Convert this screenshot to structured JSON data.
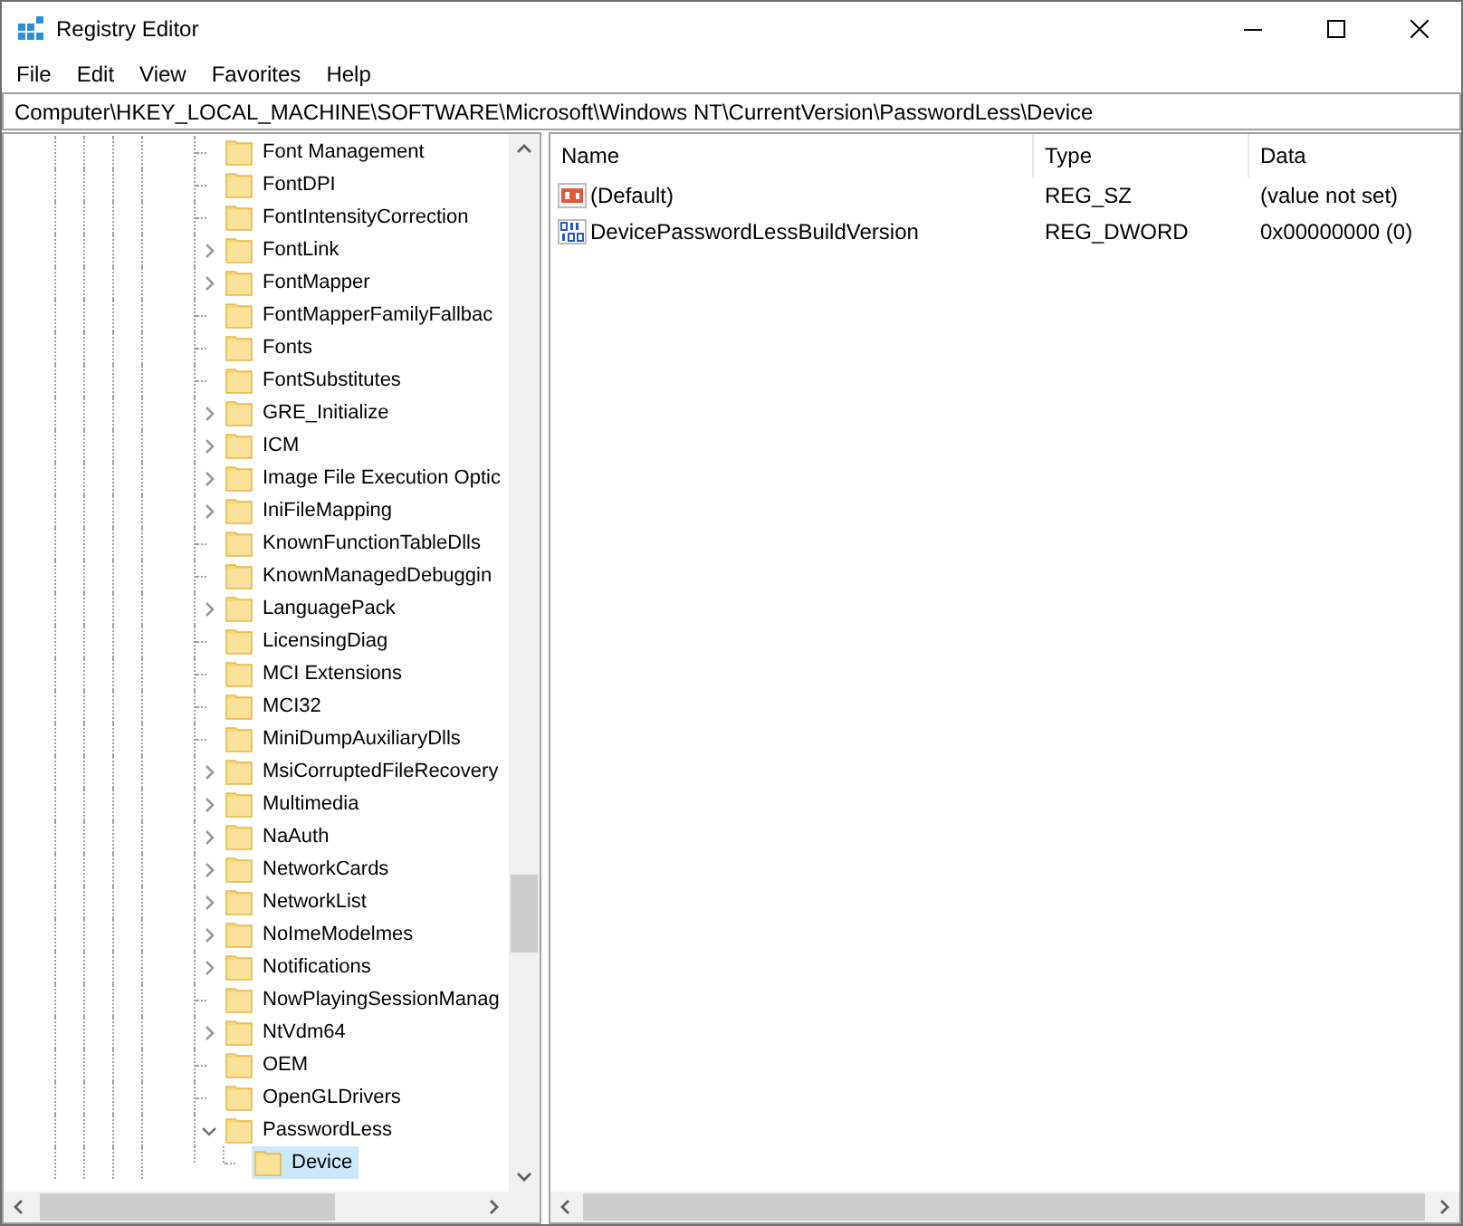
{
  "window": {
    "title": "Registry Editor"
  },
  "menu": [
    "File",
    "Edit",
    "View",
    "Favorites",
    "Help"
  ],
  "address": "Computer\\HKEY_LOCAL_MACHINE\\SOFTWARE\\Microsoft\\Windows NT\\CurrentVersion\\PasswordLess\\Device",
  "tree": {
    "items": [
      {
        "label": "Font Management",
        "expandable": false,
        "selected": false
      },
      {
        "label": "FontDPI",
        "expandable": false,
        "selected": false
      },
      {
        "label": "FontIntensityCorrection",
        "expandable": false,
        "selected": false
      },
      {
        "label": "FontLink",
        "expandable": true,
        "expanded": false,
        "selected": false
      },
      {
        "label": "FontMapper",
        "expandable": true,
        "expanded": false,
        "selected": false
      },
      {
        "label": "FontMapperFamilyFallbac",
        "expandable": false,
        "selected": false
      },
      {
        "label": "Fonts",
        "expandable": false,
        "selected": false
      },
      {
        "label": "FontSubstitutes",
        "expandable": false,
        "selected": false
      },
      {
        "label": "GRE_Initialize",
        "expandable": true,
        "expanded": false,
        "selected": false
      },
      {
        "label": "ICM",
        "expandable": true,
        "expanded": false,
        "selected": false
      },
      {
        "label": "Image File Execution Optic",
        "expandable": true,
        "expanded": false,
        "selected": false
      },
      {
        "label": "IniFileMapping",
        "expandable": true,
        "expanded": false,
        "selected": false
      },
      {
        "label": "KnownFunctionTableDlls",
        "expandable": false,
        "selected": false
      },
      {
        "label": "KnownManagedDebuggin",
        "expandable": false,
        "selected": false
      },
      {
        "label": "LanguagePack",
        "expandable": true,
        "expanded": false,
        "selected": false
      },
      {
        "label": "LicensingDiag",
        "expandable": false,
        "selected": false
      },
      {
        "label": "MCI Extensions",
        "expandable": false,
        "selected": false
      },
      {
        "label": "MCI32",
        "expandable": false,
        "selected": false
      },
      {
        "label": "MiniDumpAuxiliaryDlls",
        "expandable": false,
        "selected": false
      },
      {
        "label": "MsiCorruptedFileRecovery",
        "expandable": true,
        "expanded": false,
        "selected": false
      },
      {
        "label": "Multimedia",
        "expandable": true,
        "expanded": false,
        "selected": false
      },
      {
        "label": "NaAuth",
        "expandable": true,
        "expanded": false,
        "selected": false
      },
      {
        "label": "NetworkCards",
        "expandable": true,
        "expanded": false,
        "selected": false
      },
      {
        "label": "NetworkList",
        "expandable": true,
        "expanded": false,
        "selected": false
      },
      {
        "label": "NoImeModelmes",
        "expandable": true,
        "expanded": false,
        "selected": false
      },
      {
        "label": "Notifications",
        "expandable": true,
        "expanded": false,
        "selected": false
      },
      {
        "label": "NowPlayingSessionManag",
        "expandable": false,
        "selected": false
      },
      {
        "label": "NtVdm64",
        "expandable": true,
        "expanded": false,
        "selected": false
      },
      {
        "label": "OEM",
        "expandable": false,
        "selected": false
      },
      {
        "label": "OpenGLDrivers",
        "expandable": false,
        "selected": false
      },
      {
        "label": "PasswordLess",
        "expandable": true,
        "expanded": true,
        "selected": false,
        "children": [
          {
            "label": "Device",
            "expandable": false,
            "selected": true
          }
        ]
      }
    ]
  },
  "values": {
    "columns": [
      "Name",
      "Type",
      "Data"
    ],
    "rows": [
      {
        "kind": "string",
        "name": "(Default)",
        "type": "REG_SZ",
        "data": "(value not set)"
      },
      {
        "kind": "binary",
        "name": "DevicePasswordLessBuildVersion",
        "type": "REG_DWORD",
        "data": "0x00000000 (0)"
      }
    ]
  }
}
